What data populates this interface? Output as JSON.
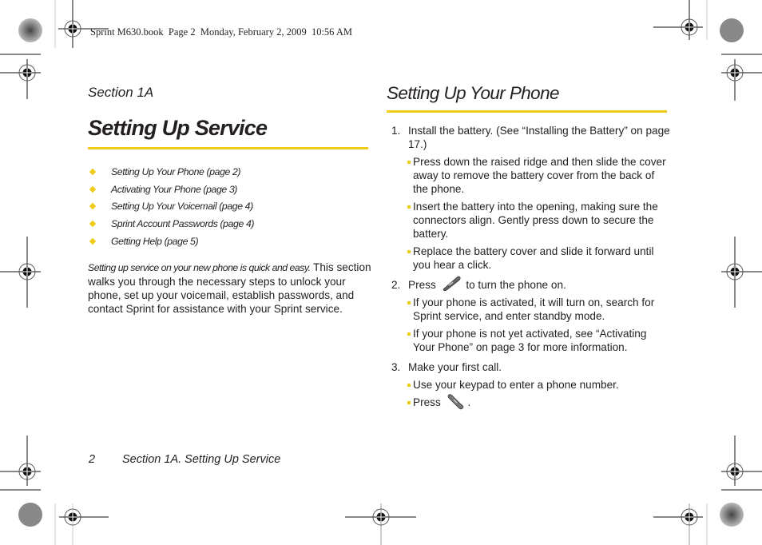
{
  "print_header": "Sprint M630.book  Page 2  Monday, February 2, 2009  10:56 AM",
  "colors": {
    "accent": "#f0cc1a",
    "text": "#231f20"
  },
  "left": {
    "section_label": "Section 1A",
    "title": "Setting Up Service",
    "toc": [
      "Setting Up Your Phone (page 2)",
      "Activating Your Phone (page 3)",
      "Setting Up Your Voicemail (page 4)",
      "Sprint Account Passwords (page 4)",
      "Getting Help (page 5)"
    ],
    "intro_lead": "Setting up service on your new phone is quick and easy.",
    "intro_body": " This section walks you through the necessary steps to unlock your phone, set up your voicemail, establish passwords, and contact Sprint for assistance with your Sprint service."
  },
  "right": {
    "title": "Setting Up Your Phone",
    "steps": [
      {
        "num": "1.",
        "text": "Install the battery. (See “Installing the Battery” on page 17.)",
        "subs": [
          "Press down the raised ridge and then slide the cover away to remove the battery cover from the back of the phone.",
          "Insert the battery into the opening, making sure the connectors align. Gently press down to secure the battery.",
          "Replace the battery cover and slide it forward until you hear a click."
        ]
      },
      {
        "num": "2.",
        "text_before": "Press",
        "icon": "end-power-key-icon",
        "text_after": "to turn the phone on.",
        "subs": [
          "If your phone is activated, it will turn on, search for Sprint service, and enter standby mode.",
          "If your phone is not yet activated, see “Activating Your Phone” on page 3 for more information."
        ]
      },
      {
        "num": "3.",
        "text": "Make your first call.",
        "subs": [
          "Use your keypad to enter a phone number."
        ],
        "last_sub_before": "Press",
        "last_sub_icon": "talk-key-icon",
        "last_sub_after": "."
      }
    ]
  },
  "footer": {
    "page_number": "2",
    "running_title": "Section 1A. Setting Up Service"
  }
}
